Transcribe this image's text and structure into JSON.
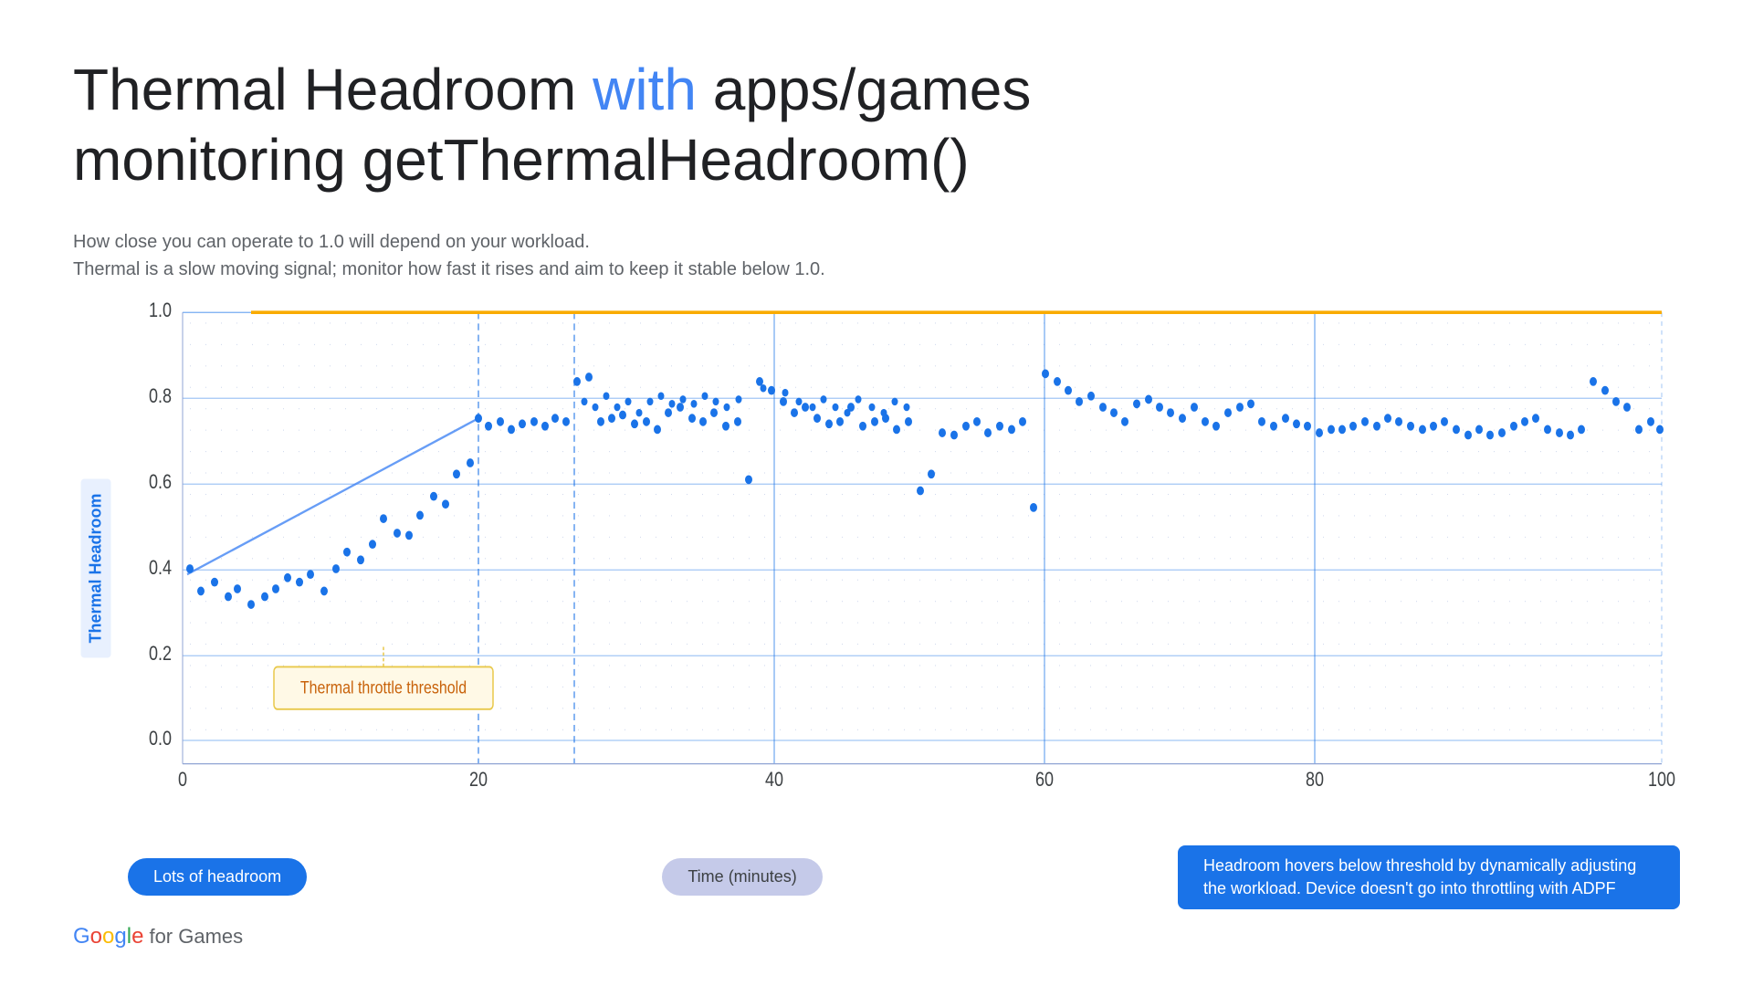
{
  "title": {
    "part1": "Thermal Headroom ",
    "highlight": "with",
    "part2": " apps/games",
    "line2": "monitoring getThermalHeadroom()"
  },
  "subtitle": {
    "line1": "How close you can operate to 1.0 will depend on your workload.",
    "line2": "Thermal is a slow moving signal; monitor how fast it rises and aim to keep it stable below 1.0."
  },
  "chart": {
    "y_axis_label": "Thermal Headroom",
    "x_axis_label": "Time (minutes)",
    "threshold_label": "Thermal throttle threshold",
    "y_ticks": [
      "1.0",
      "0.8",
      "0.6",
      "0.4",
      "0.2",
      "0.0"
    ],
    "x_ticks": [
      "0",
      "20",
      "40",
      "60",
      "80",
      "100"
    ]
  },
  "bottom_labels": {
    "left": "Lots of headroom",
    "center": "Time (minutes)",
    "right": "Headroom hovers below threshold by dynamically adjusting the workload. Device doesn't go into throttling with ADPF"
  },
  "google_logo": {
    "google": "Google",
    "for_games": " for Games"
  }
}
